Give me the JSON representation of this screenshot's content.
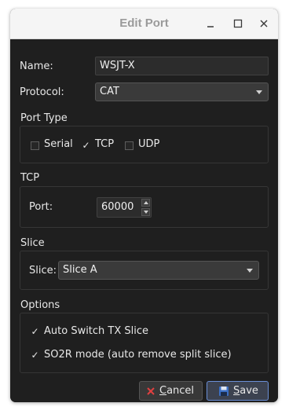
{
  "window": {
    "title": "Edit Port"
  },
  "fields": {
    "name_label": "Name:",
    "name_value": "WSJT-X",
    "protocol_label": "Protocol:",
    "protocol_value": "CAT"
  },
  "port_type": {
    "title": "Port Type",
    "options": [
      {
        "label": "Serial",
        "checked": false
      },
      {
        "label": "TCP",
        "checked": true
      },
      {
        "label": "UDP",
        "checked": false
      }
    ]
  },
  "tcp": {
    "title": "TCP",
    "port_label": "Port:",
    "port_value": "60000"
  },
  "slice": {
    "title": "Slice",
    "slice_label": "Slice:",
    "slice_value": "Slice A"
  },
  "options": {
    "title": "Options",
    "items": [
      {
        "label": "Auto Switch TX Slice",
        "checked": true
      },
      {
        "label": "SO2R mode (auto remove split slice)",
        "checked": true
      }
    ]
  },
  "buttons": {
    "cancel_c": "C",
    "cancel_rest": "ancel",
    "save_s": "S",
    "save_rest": "ave"
  },
  "colors": {
    "window_bg": "#1f1f1f",
    "titlebar_bg": "#f5f5f5",
    "accent": "#6a8fd6",
    "cancel_icon": "#e04040",
    "save_icon": "#3b6fc4"
  }
}
